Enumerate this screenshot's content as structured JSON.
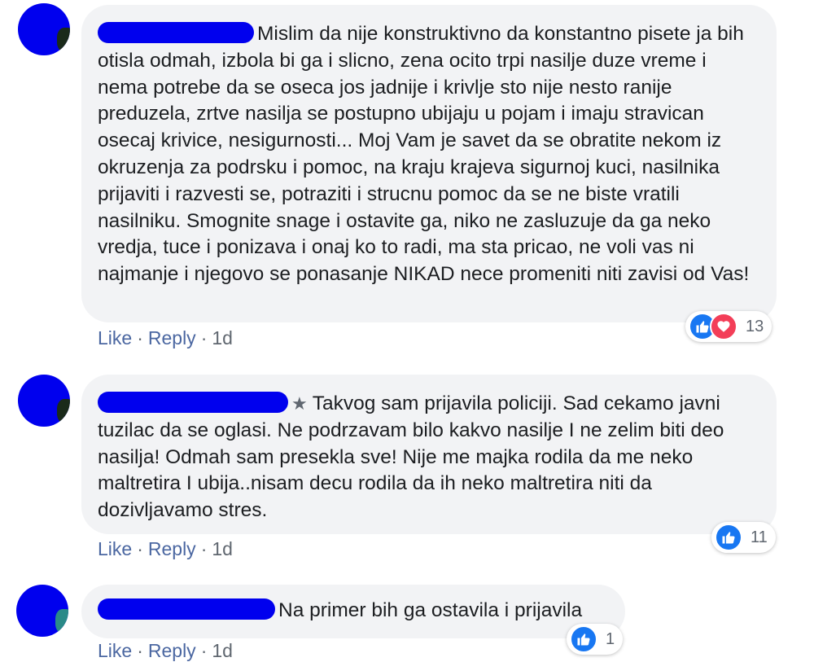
{
  "actions": {
    "like": "Like",
    "reply": "Reply",
    "separator": "·"
  },
  "comments": [
    {
      "text": "Mislim da nije konstruktivno da konstantno pisete ja bih otisla odmah, izbola bi ga i slicno, zena ocito trpi nasilje duze vreme i nema potrebe da se oseca jos jadnije i krivlje sto nije nesto ranije preduzela, zrtve nasilja se postupno ubijaju u pojam i imaju stravican osecaj krivice, nesigurnosti... Moj Vam je savet da se obratite nekom iz okruzenja za podrsku i pomoc, na kraju krajeva sigurnoj kuci, nasilnika prijaviti i razvesti se, potraziti i strucnu pomoc da se ne biste vratili nasilniku. Smognite snage i ostavite ga, niko ne zasluzuje da ga neko vredja, tuce i ponizava i onaj ko to radi, ma sta pricao, ne voli vas ni najmanje i njegovo se ponasanje NIKAD nece promeniti niti zavisi od Vas!",
      "time": "1d",
      "reaction_count": "13",
      "reactions": [
        "like-icon",
        "love-icon"
      ]
    },
    {
      "text": "Takvog sam prijavila policiji. Sad cekamo javni tuzilac da se oglasi. Ne podrzavam bilo kakvo nasilje I ne zelim biti deo nasilja! Odmah sam presekla sve! Nije me majka rodila da me neko maltretira I ubija..nisam decu rodila da ih neko maltretira niti da dozivljavamo stres.",
      "time": "1d",
      "reaction_count": "11",
      "reactions": [
        "like-icon"
      ],
      "badge_icon": "star-icon"
    },
    {
      "text": "Na primer bih ga ostavila i prijavila",
      "time": "1d",
      "reaction_count": "1",
      "reactions": [
        "like-icon"
      ]
    }
  ],
  "colors": {
    "bubble": "#f2f3f5",
    "redaction": "#0000ee",
    "link": "#4b67a1",
    "like": "#1877f2",
    "love": "#f33e58"
  }
}
